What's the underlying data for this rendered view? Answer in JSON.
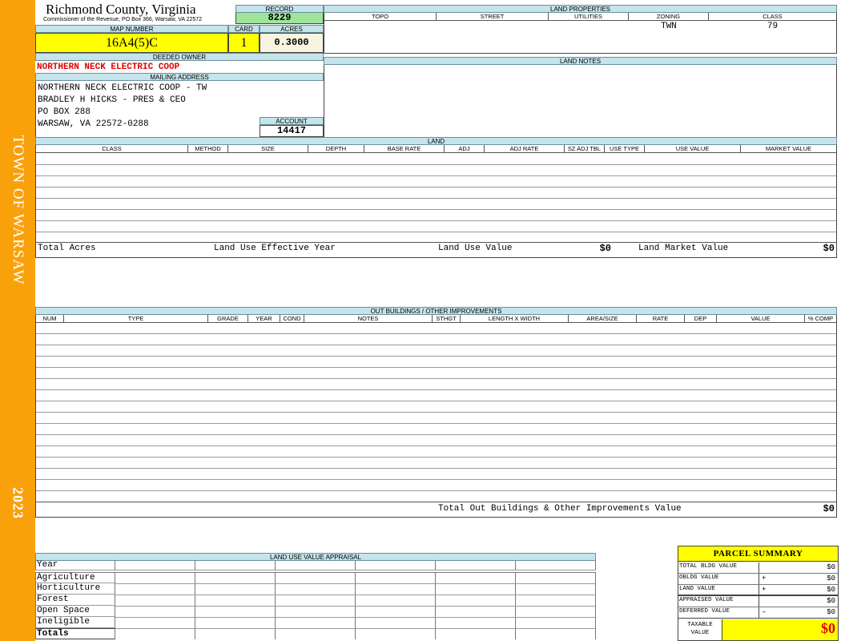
{
  "sidebar": {
    "town": "TOWN OF WARSAW",
    "year": "2023"
  },
  "header": {
    "county": "Richmond County, Virginia",
    "commissioner": "Commissioner of the Revenue, PO Box 366, Warsaw, VA 22572"
  },
  "record": {
    "label": "RECORD",
    "value": "8229"
  },
  "map_number": {
    "label": "MAP NUMBER",
    "value": "16A4(5)C"
  },
  "card": {
    "label": "CARD",
    "value": "1"
  },
  "acres": {
    "label": "ACRES",
    "value": "0.3000"
  },
  "deeded_owner": {
    "label": "DEEDED OWNER",
    "value": "NORTHERN NECK ELECTRIC COOP"
  },
  "mailing_address": {
    "label": "MAILING ADDRESS",
    "lines": [
      "NORTHERN NECK ELECTRIC COOP - TW",
      "BRADLEY H HICKS - PRES & CEO",
      "PO BOX 288",
      "WARSAW, VA 22572-0288"
    ]
  },
  "account": {
    "label": "ACCOUNT",
    "value": "14417"
  },
  "land_properties": {
    "title": "LAND PROPERTIES",
    "columns": [
      "TOPO",
      "STREET",
      "UTILITIES",
      "ZONING",
      "CLASS"
    ],
    "values": [
      "",
      "",
      "",
      "TWN",
      "79"
    ]
  },
  "land_notes": {
    "title": "LAND NOTES"
  },
  "land": {
    "title": "LAND",
    "columns": [
      "CLASS",
      "METHOD",
      "SIZE",
      "DEPTH",
      "BASE RATE",
      "ADJ",
      "ADJ RATE",
      "SZ ADJ TBL",
      "USE TYPE",
      "USE VALUE",
      "MARKET VALUE"
    ],
    "summary": {
      "total_acres": "Total Acres",
      "effective_year": "Land Use Effective Year",
      "use_value_label": "Land Use Value",
      "use_value": "$0",
      "market_value_label": "Land Market Value",
      "market_value": "$0"
    }
  },
  "outbuildings": {
    "title": "OUT BUILDINGS / OTHER IMPROVEMENTS",
    "columns": [
      "NUM",
      "TYPE",
      "GRADE",
      "YEAR",
      "COND",
      "NOTES",
      "STHGT",
      "LENGTH X WIDTH",
      "AREA/SIZE",
      "RATE",
      "DEP",
      "VALUE",
      "% COMP"
    ],
    "total_label": "Total Out Buildings & Other Improvements Value",
    "total_value": "$0"
  },
  "land_use_appraisal": {
    "title": "LAND USE VALUE APPRAISAL",
    "rows": [
      "Year",
      "Agriculture",
      "Horticulture",
      "Forest",
      "Open Space",
      "Ineligible",
      "Totals"
    ]
  },
  "parcel_summary": {
    "title": "PARCEL SUMMARY",
    "rows": [
      {
        "label": "TOTAL BLDG VALUE",
        "op": "",
        "value": "$0"
      },
      {
        "label": "OBLDG VALUE",
        "op": "+",
        "value": "$0"
      },
      {
        "label": "LAND VALUE",
        "op": "+",
        "value": "$0"
      },
      {
        "label": "APPRAISED VALUE",
        "op": "",
        "value": "$0"
      },
      {
        "label": "DEFERRED VALUE",
        "op": "–",
        "value": "$0"
      }
    ],
    "taxable_label": "TAXABLE VALUE",
    "taxable_value": "$0"
  },
  "colors": {
    "accent": "#f9a10a",
    "header_band": "#c5e4ec",
    "highlight": "#ffff00",
    "record_green": "#9ee59a",
    "owner_red": "#e00000"
  }
}
